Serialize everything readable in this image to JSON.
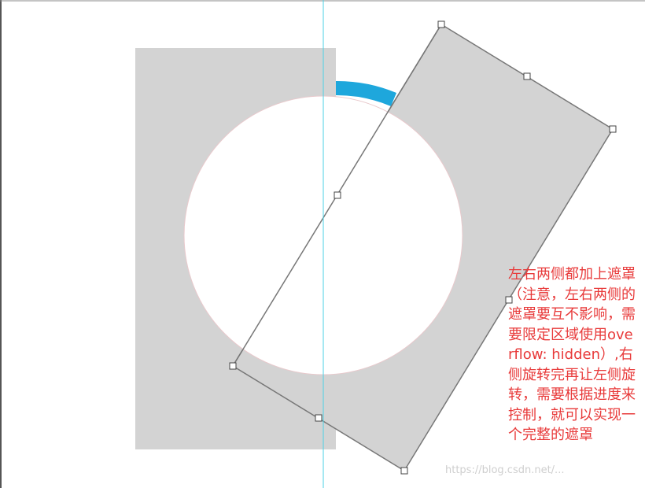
{
  "annotation": {
    "text": "左右两侧都加上遮罩（注意，左右两侧的遮罩要互不影响，需要限定区域使用overflow: hidden）,右侧旋转完再让左侧旋转，需要根据进度来控制，就可以实现一个完整的遮罩"
  },
  "watermark": {
    "text": "https://blog.csdn.net/..."
  },
  "colors": {
    "mask": "#d3d3d3",
    "progress": "#1ea7dc",
    "guide": "#4dd2e6",
    "note": "#e83a3a",
    "handle_stroke": "#444444"
  }
}
